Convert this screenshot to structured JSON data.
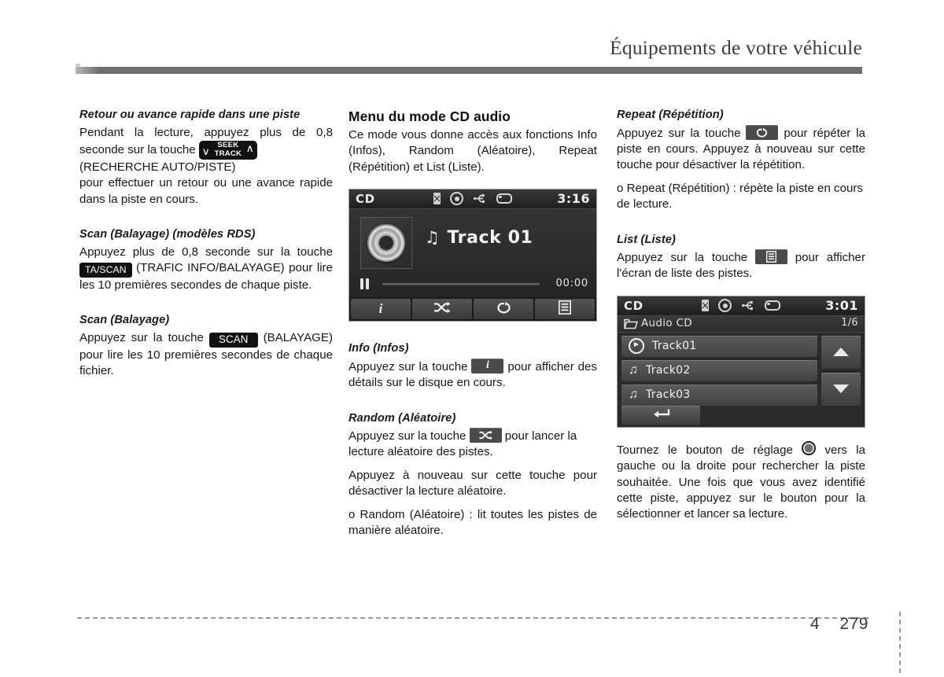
{
  "header": {
    "title": "Équipements de votre véhicule"
  },
  "footer": {
    "chapter": "4",
    "page": "279"
  },
  "left_column": {
    "s1": {
      "heading": "Retour ou avance rapide dans une piste",
      "p1_a": "Pendant la lecture, appuyez plus de 0,8 seconde sur la touche",
      "key_seek_line1": "SEEK",
      "key_seek_line2": "TRACK",
      "p1_b": "(RECHERCHE AUTO/PISTE)",
      "p1_c": "pour effectuer un retour ou une avance rapide dans la piste en cours."
    },
    "s2": {
      "heading": "Scan (Balayage) (modèles RDS)",
      "p_a": "Appuyez plus de 0,8 seconde sur la touche",
      "key": "TA/SCAN",
      "p_b": "(TRAFIC INFO/BALAYAGE) pour lire les 10 premières secondes de chaque piste."
    },
    "s3": {
      "heading": "Scan (Balayage)",
      "p_a": "Appuyez sur la touche",
      "key": "SCAN",
      "p_b": "(BALAYAGE) pour lire les 10 premières secondes de chaque fichier."
    }
  },
  "mid_column": {
    "heading": "Menu du mode CD audio",
    "intro": "Ce mode vous donne accès aux fonctions Info (Infos), Random (Aléatoire), Repeat (Répétition) et List (Liste).",
    "player": {
      "source": "CD",
      "clock": "3:16",
      "status_icons": [
        "bluetooth-icon",
        "disc-icon",
        "usb-icon",
        "aux-icon"
      ],
      "track_title": "Track 01",
      "note_glyph": "♫",
      "elapsed": "00:00",
      "transport_state": "pause",
      "toolbar": [
        {
          "name": "info-button",
          "icon": "info-icon",
          "label": "i"
        },
        {
          "name": "random-button",
          "icon": "shuffle-icon",
          "label": ""
        },
        {
          "name": "repeat-button",
          "icon": "repeat-icon",
          "label": ""
        },
        {
          "name": "list-button",
          "icon": "list-icon",
          "label": ""
        }
      ]
    },
    "s_info": {
      "heading": "Info (Infos)",
      "p_a": "Appuyez sur la touche",
      "p_b": "pour afficher des détails sur le disque en cours."
    },
    "s_random": {
      "heading": "Random (Aléatoire)",
      "p_a": "Appuyez sur la touche",
      "p_b": "pour lancer la lecture aléatoire des pistes.",
      "p2": "Appuyez à nouveau sur cette touche pour désactiver la lecture aléatoire.",
      "p3": "o Random (Aléatoire) : lit toutes les pistes de manière aléatoire."
    }
  },
  "right_column": {
    "s_repeat": {
      "heading": "Repeat (Répétition)",
      "p_a": "Appuyez sur la touche",
      "p_b": "pour répéter la piste en cours. Appuyez à nouveau sur cette touche pour désactiver la répétition.",
      "p2": "o Repeat (Répétition) : répète la piste en cours de lecture."
    },
    "s_list": {
      "heading": "List (Liste)",
      "p_a": "Appuyez sur la touche",
      "p_b": "pour afficher l'écran de liste des pistes."
    },
    "list_screen": {
      "source": "CD",
      "clock": "3:01",
      "status_icons": [
        "bluetooth-icon",
        "disc-icon",
        "usb-icon",
        "aux-icon"
      ],
      "folder_label": "Audio CD",
      "page_counter": "1/6",
      "tracks": [
        {
          "label": "Track01",
          "icon": "play-circle-icon"
        },
        {
          "label": "Track02",
          "icon": "music-note-icon"
        },
        {
          "label": "Track03",
          "icon": "music-note-icon"
        }
      ],
      "scroll_up": "scroll-up-icon",
      "scroll_down": "scroll-down-icon",
      "back": "back-arrow-icon"
    },
    "outro_a": "Tournez le bouton de réglage",
    "outro_b": "vers la gauche ou la droite pour rechercher la piste souhaitée. Une fois que vous avez identifié cette piste, appuyez sur le bouton pour la sélectionner et lancer sa lecture."
  }
}
